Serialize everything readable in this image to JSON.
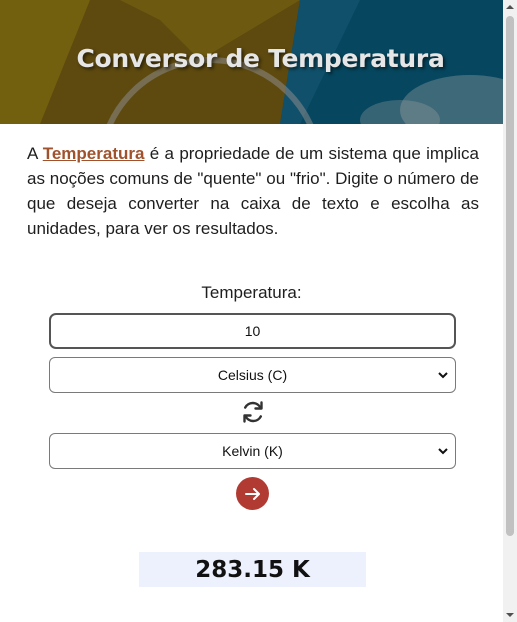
{
  "header": {
    "title": "Conversor de Temperatura"
  },
  "intro": {
    "prefix": "A ",
    "link_text": "Temperatura",
    "suffix": " é a propriedade de um sistema que implica as noções comuns de \"quente\" ou \"frio\". Digite o número de que deseja converter na caixa de texto e escolha as unidades, para ver os resultados."
  },
  "form": {
    "label": "Temperatura:",
    "input_value": "10",
    "from_unit": "Celsius (C)",
    "to_unit": "Kelvin (K)"
  },
  "result": {
    "text": "283.15 K"
  },
  "icons": {
    "swap": "refresh-icon",
    "convert": "arrow-right-icon",
    "select": "chevron-down-icon"
  },
  "colors": {
    "banner": "#06475f",
    "link": "#a0522d",
    "convert_button": "#b13a33",
    "result_background": "#ecf1fd"
  }
}
